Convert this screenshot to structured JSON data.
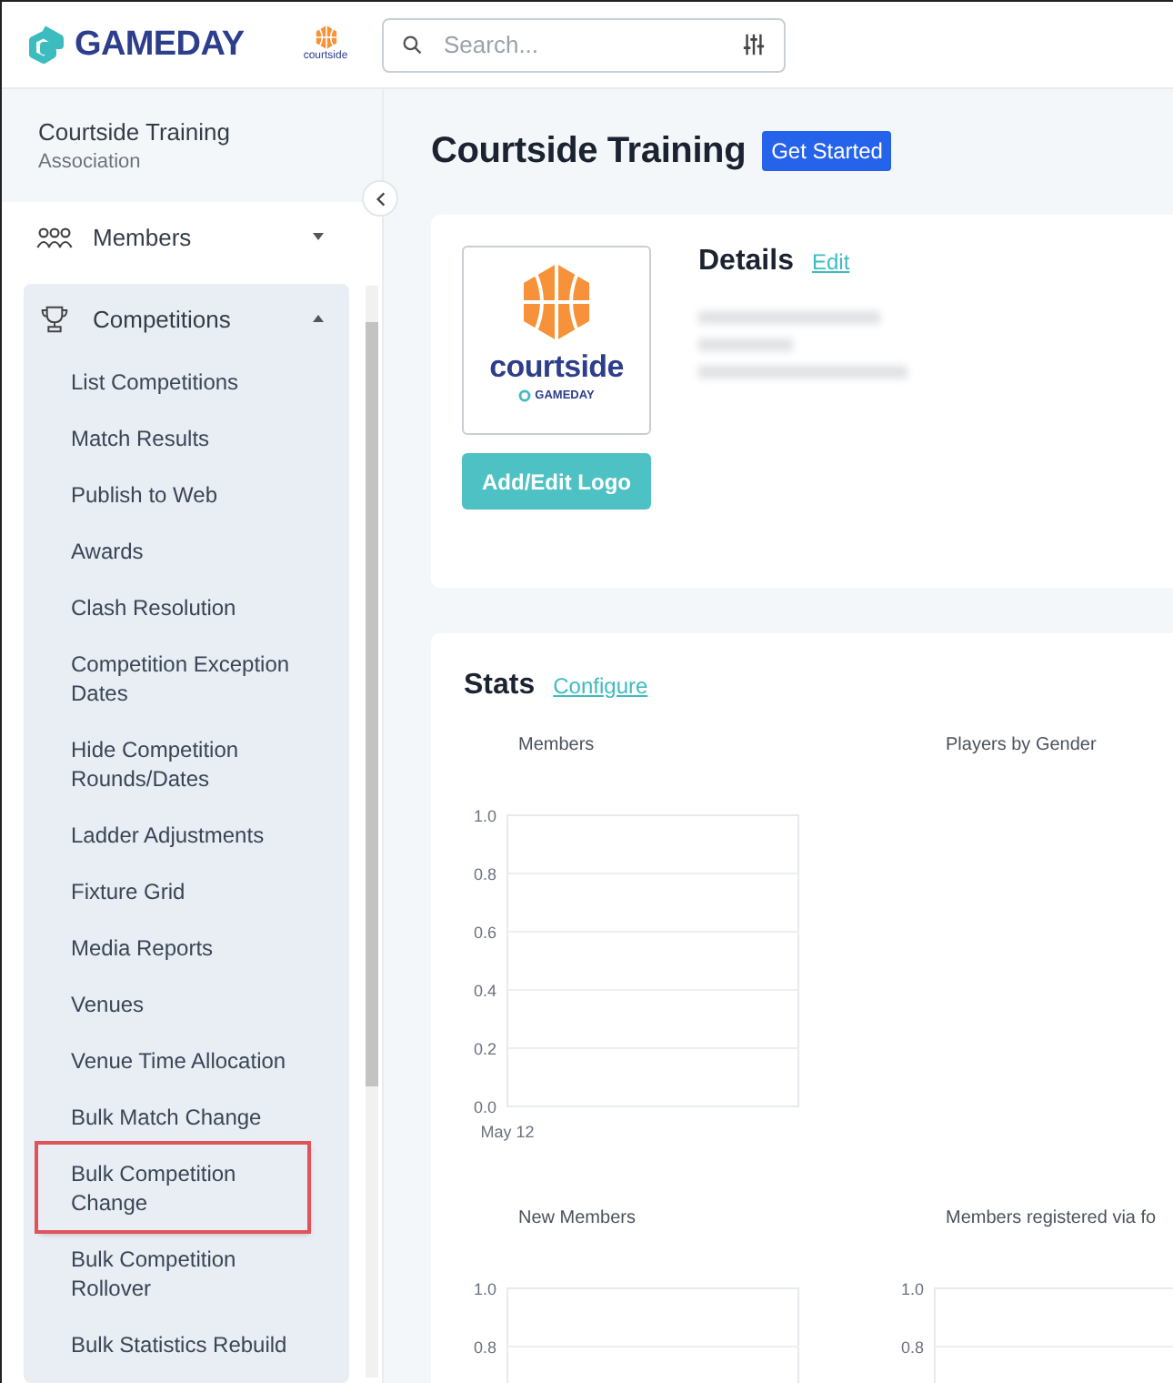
{
  "header": {
    "brand": "GAMEDAY",
    "org_logo_text": "courtside",
    "search": {
      "placeholder": "Search..."
    }
  },
  "sidebar": {
    "org_name": "Courtside Training",
    "org_type": "Association",
    "groups": [
      {
        "label": "Members",
        "expanded": false
      },
      {
        "label": "Competitions",
        "expanded": true,
        "items": [
          {
            "label": "List Competitions",
            "highlighted": false
          },
          {
            "label": "Match Results",
            "highlighted": false
          },
          {
            "label": "Publish to Web",
            "highlighted": false
          },
          {
            "label": "Awards",
            "highlighted": false
          },
          {
            "label": "Clash Resolution",
            "highlighted": false
          },
          {
            "label": "Competition Exception Dates",
            "highlighted": false
          },
          {
            "label": "Hide Competition Rounds/Dates",
            "highlighted": false
          },
          {
            "label": "Ladder Adjustments",
            "highlighted": false
          },
          {
            "label": "Fixture Grid",
            "highlighted": false
          },
          {
            "label": "Media Reports",
            "highlighted": false
          },
          {
            "label": "Venues",
            "highlighted": false
          },
          {
            "label": "Venue Time Allocation",
            "highlighted": false
          },
          {
            "label": "Bulk Match Change",
            "highlighted": false
          },
          {
            "label": "Bulk Competition Change",
            "highlighted": true
          },
          {
            "label": "Bulk Competition Rollover",
            "highlighted": false
          },
          {
            "label": "Bulk Statistics Rebuild",
            "highlighted": false
          }
        ]
      }
    ]
  },
  "page": {
    "title": "Courtside Training",
    "badge": "Get Started"
  },
  "details_card": {
    "logo_text": "courtside",
    "logo_subtext": "GAMEDAY",
    "logo_button": "Add/Edit Logo",
    "heading": "Details",
    "edit_link": "Edit"
  },
  "stats_card": {
    "heading": "Stats",
    "configure_link": "Configure",
    "charts": [
      {
        "kind": "plot",
        "chart_data": {
          "type": "line",
          "title": "Members",
          "grid": true,
          "categories": [
            "May 12"
          ],
          "values": [
            null
          ],
          "ylim": [
            0,
            1
          ],
          "yticks": [
            {
              "value": 0,
              "label": "0.0"
            },
            {
              "value": 0.2,
              "label": "0.2"
            },
            {
              "value": 0.4,
              "label": "0.4"
            },
            {
              "value": 0.6,
              "label": "0.6"
            },
            {
              "value": 0.8,
              "label": "0.8"
            },
            {
              "value": 1,
              "label": "1.0"
            }
          ]
        }
      },
      {
        "kind": "empty",
        "title": "Players by Gender"
      },
      {
        "kind": "plot",
        "chart_data": {
          "type": "line",
          "title": "New Members",
          "grid": true,
          "categories": [
            null
          ],
          "values": [
            null
          ],
          "ylim": [
            0,
            1
          ],
          "yticks": [
            {
              "value": 0.8,
              "label": "0.8"
            },
            {
              "value": 1,
              "label": "1.0"
            }
          ]
        }
      },
      {
        "kind": "plot",
        "chart_data": {
          "type": "line",
          "title": "Members registered via fo",
          "grid": true,
          "categories": [
            null
          ],
          "values": [
            null
          ],
          "ylim": [
            0,
            1
          ],
          "yticks": [
            {
              "value": 0.8,
              "label": "0.8"
            },
            {
              "value": 1,
              "label": "1.0"
            }
          ]
        }
      }
    ]
  }
}
